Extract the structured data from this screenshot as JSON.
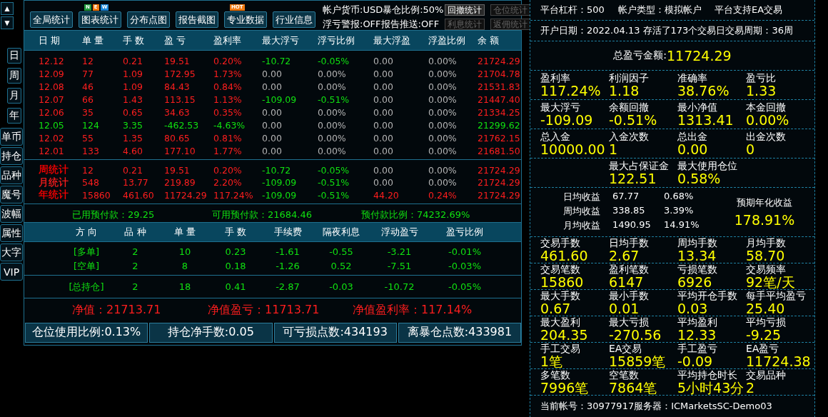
{
  "scroll_buttons": [
    "▲",
    "▼"
  ],
  "period_buttons": [
    "日",
    "周",
    "月",
    "年"
  ],
  "side_buttons": [
    "单币",
    "持仓",
    "品种",
    "魔号",
    "波幅",
    "属性",
    "大字",
    "VIP"
  ],
  "toolbar": {
    "buttons": [
      {
        "label": "全局统计"
      },
      {
        "label": "图表统计",
        "badges": [
          {
            "text": "N",
            "color": "#1f9a3c"
          },
          {
            "text": "E",
            "color": "#f07a12"
          },
          {
            "text": "W",
            "color": "#1a86d8"
          }
        ]
      },
      {
        "label": "分布点图"
      },
      {
        "label": "报告截图"
      },
      {
        "label": "专业数据",
        "badges": [
          {
            "text": "HOT",
            "color": "#f07a12"
          }
        ]
      },
      {
        "label": "行业信息"
      }
    ],
    "info_lines": [
      "帐户货币:USD暴仓比例:50%",
      "浮亏警报:OFF报告推送:OFF"
    ],
    "small_buttons": [
      {
        "label": "回撤统计",
        "disabled": false
      },
      {
        "label": "仓位统计",
        "disabled": true
      },
      {
        "label": "利息统计",
        "disabled": true
      },
      {
        "label": "返佣统计",
        "disabled": true
      }
    ]
  },
  "daily_table": {
    "columns": [
      "日 期",
      "单 量",
      "手 数",
      "盈 亏",
      "盈利率",
      "最大浮亏",
      "浮亏比例",
      "最大浮盈",
      "浮盈比例",
      "余 额"
    ],
    "rows": [
      [
        {
          "text": "12.12",
          "color": "#ff1e1e"
        },
        {
          "text": "12",
          "color": "#ff1e1e"
        },
        {
          "text": "0.21",
          "color": "#ff1e1e"
        },
        {
          "text": "19.51",
          "color": "#ff1e1e"
        },
        {
          "text": "0.20%",
          "color": "#ff1e1e"
        },
        {
          "text": "-10.72",
          "color": "#10e010"
        },
        {
          "text": "-0.05%",
          "color": "#10e010"
        },
        {
          "text": "0.00",
          "color": "#b4b4b4"
        },
        {
          "text": "0.00%",
          "color": "#b4b4b4"
        },
        {
          "text": "21724.29",
          "color": "#ff1e1e"
        }
      ],
      [
        {
          "text": "12.09",
          "color": "#ff1e1e"
        },
        {
          "text": "77",
          "color": "#ff1e1e"
        },
        {
          "text": "1.09",
          "color": "#ff1e1e"
        },
        {
          "text": "172.95",
          "color": "#ff1e1e"
        },
        {
          "text": "1.73%",
          "color": "#ff1e1e"
        },
        {
          "text": "0.00",
          "color": "#b4b4b4"
        },
        {
          "text": "0.00%",
          "color": "#b4b4b4"
        },
        {
          "text": "0.00",
          "color": "#b4b4b4"
        },
        {
          "text": "0.00%",
          "color": "#b4b4b4"
        },
        {
          "text": "21704.78",
          "color": "#ff1e1e"
        }
      ],
      [
        {
          "text": "12.08",
          "color": "#ff1e1e"
        },
        {
          "text": "46",
          "color": "#ff1e1e"
        },
        {
          "text": "1.09",
          "color": "#ff1e1e"
        },
        {
          "text": "84.43",
          "color": "#ff1e1e"
        },
        {
          "text": "0.84%",
          "color": "#ff1e1e"
        },
        {
          "text": "0.00",
          "color": "#b4b4b4"
        },
        {
          "text": "0.00%",
          "color": "#b4b4b4"
        },
        {
          "text": "0.00",
          "color": "#b4b4b4"
        },
        {
          "text": "0.00%",
          "color": "#b4b4b4"
        },
        {
          "text": "21531.83",
          "color": "#ff1e1e"
        }
      ],
      [
        {
          "text": "12.07",
          "color": "#ff1e1e"
        },
        {
          "text": "66",
          "color": "#ff1e1e"
        },
        {
          "text": "1.43",
          "color": "#ff1e1e"
        },
        {
          "text": "113.15",
          "color": "#ff1e1e"
        },
        {
          "text": "1.13%",
          "color": "#ff1e1e"
        },
        {
          "text": "-109.09",
          "color": "#10e010"
        },
        {
          "text": "-0.51%",
          "color": "#10e010"
        },
        {
          "text": "0.00",
          "color": "#b4b4b4"
        },
        {
          "text": "0.00%",
          "color": "#b4b4b4"
        },
        {
          "text": "21447.40",
          "color": "#ff1e1e"
        }
      ],
      [
        {
          "text": "12.06",
          "color": "#ff1e1e"
        },
        {
          "text": "35",
          "color": "#ff1e1e"
        },
        {
          "text": "0.65",
          "color": "#ff1e1e"
        },
        {
          "text": "34.63",
          "color": "#ff1e1e"
        },
        {
          "text": "0.35%",
          "color": "#ff1e1e"
        },
        {
          "text": "0.00",
          "color": "#b4b4b4"
        },
        {
          "text": "0.00%",
          "color": "#b4b4b4"
        },
        {
          "text": "0.00",
          "color": "#b4b4b4"
        },
        {
          "text": "0.00%",
          "color": "#b4b4b4"
        },
        {
          "text": "21334.25",
          "color": "#ff1e1e"
        }
      ],
      [
        {
          "text": "12.05",
          "color": "#10e010"
        },
        {
          "text": "124",
          "color": "#10e010"
        },
        {
          "text": "3.35",
          "color": "#10e010"
        },
        {
          "text": "-462.53",
          "color": "#10e010"
        },
        {
          "text": "-4.63%",
          "color": "#10e010"
        },
        {
          "text": "0.00",
          "color": "#b4b4b4"
        },
        {
          "text": "0.00%",
          "color": "#b4b4b4"
        },
        {
          "text": "0.00",
          "color": "#b4b4b4"
        },
        {
          "text": "0.00%",
          "color": "#b4b4b4"
        },
        {
          "text": "21299.62",
          "color": "#10e010"
        }
      ],
      [
        {
          "text": "12.02",
          "color": "#ff1e1e"
        },
        {
          "text": "55",
          "color": "#ff1e1e"
        },
        {
          "text": "1.35",
          "color": "#ff1e1e"
        },
        {
          "text": "80.65",
          "color": "#ff1e1e"
        },
        {
          "text": "0.81%",
          "color": "#ff1e1e"
        },
        {
          "text": "0.00",
          "color": "#b4b4b4"
        },
        {
          "text": "0.00%",
          "color": "#b4b4b4"
        },
        {
          "text": "0.00",
          "color": "#b4b4b4"
        },
        {
          "text": "0.00%",
          "color": "#b4b4b4"
        },
        {
          "text": "21762.15",
          "color": "#ff1e1e"
        }
      ],
      [
        {
          "text": "12.01",
          "color": "#ff1e1e"
        },
        {
          "text": "133",
          "color": "#ff1e1e"
        },
        {
          "text": "4.60",
          "color": "#ff1e1e"
        },
        {
          "text": "177.10",
          "color": "#ff1e1e"
        },
        {
          "text": "1.77%",
          "color": "#ff1e1e"
        },
        {
          "text": "0.00",
          "color": "#b4b4b4"
        },
        {
          "text": "0.00%",
          "color": "#b4b4b4"
        },
        {
          "text": "0.00",
          "color": "#b4b4b4"
        },
        {
          "text": "0.00%",
          "color": "#b4b4b4"
        },
        {
          "text": "21681.50",
          "color": "#ff1e1e"
        }
      ]
    ],
    "summary_rows": [
      [
        {
          "text": "周统计",
          "color": "#ff0000"
        },
        {
          "text": "12",
          "color": "#ff1e1e"
        },
        {
          "text": "0.21",
          "color": "#ff1e1e"
        },
        {
          "text": "19.51",
          "color": "#ff1e1e"
        },
        {
          "text": "0.20%",
          "color": "#ff1e1e"
        },
        {
          "text": "-10.72",
          "color": "#10e010"
        },
        {
          "text": "-0.05%",
          "color": "#10e010"
        },
        {
          "text": "0.00",
          "color": "#b4b4b4"
        },
        {
          "text": "0.00%",
          "color": "#b4b4b4"
        },
        {
          "text": "21724.29",
          "color": "#ff1e1e"
        }
      ],
      [
        {
          "text": "月统计",
          "color": "#ff1e1e"
        },
        {
          "text": "548",
          "color": "#ff1e1e"
        },
        {
          "text": "13.77",
          "color": "#ff1e1e"
        },
        {
          "text": "219.89",
          "color": "#ff1e1e"
        },
        {
          "text": "2.20%",
          "color": "#ff1e1e"
        },
        {
          "text": "-109.09",
          "color": "#10e010"
        },
        {
          "text": "-0.51%",
          "color": "#10e010"
        },
        {
          "text": "0.00",
          "color": "#b4b4b4"
        },
        {
          "text": "0.00%",
          "color": "#b4b4b4"
        },
        {
          "text": "21724.29",
          "color": "#ff1e1e"
        }
      ],
      [
        {
          "text": "年统计",
          "color": "#ff0000"
        },
        {
          "text": "15860",
          "color": "#ff1e1e"
        },
        {
          "text": "461.60",
          "color": "#ff1e1e"
        },
        {
          "text": "11724.29",
          "color": "#ff1e1e"
        },
        {
          "text": "117.24%",
          "color": "#ff1e1e"
        },
        {
          "text": "-109.09",
          "color": "#10e010"
        },
        {
          "text": "-0.51%",
          "color": "#10e010"
        },
        {
          "text": "44.20",
          "color": "#ff1e1e"
        },
        {
          "text": "0.24%",
          "color": "#ff1e1e"
        },
        {
          "text": "21724.29",
          "color": "#ff1e1e"
        }
      ]
    ]
  },
  "margin_line": [
    "已用预付款：29.25",
    "可用预付款：21684.46",
    "预付款比例：74232.69%"
  ],
  "positions_table": {
    "columns": [
      "方 向",
      "品 种",
      "单 量",
      "手 数",
      "手续费",
      "隔夜利息",
      "浮动盈亏",
      "盈亏比例"
    ],
    "rows": [
      [
        "[多单]",
        "2",
        "10",
        "0.23",
        "-1.61",
        "-0.55",
        "-3.21",
        "-0.01%"
      ],
      [
        "[空单]",
        "2",
        "8",
        "0.18",
        "-1.26",
        "0.52",
        "-7.51",
        "-0.03%"
      ]
    ],
    "total_row": [
      "[总持仓]",
      "2",
      "18",
      "0.41",
      "-2.87",
      "-0.03",
      "-10.72",
      "-0.05%"
    ]
  },
  "equity_line": [
    "净值：21713.71",
    "净值盈亏：11713.71",
    "净值盈利率：117.14%"
  ],
  "bottom_stats": [
    "仓位使用比例:0.13%",
    "持仓净手数:0.05",
    "可亏损点数:434193",
    "离暴仓点数:433981"
  ],
  "stats_panel": {
    "account_line": [
      "平台杠杆：500",
      "帐户类型：模拟帐户",
      "平台支持EA交易"
    ],
    "open_info": "开户日期：2022.04.13 存活了173个交易日交易周期：36周",
    "total_label": "总盈亏金额:",
    "total_value": "11724.29",
    "groups_top": [
      [
        {
          "label": "盈利率",
          "value": "117.24%"
        },
        {
          "label": "利润因子",
          "value": "1.18"
        },
        {
          "label": "准确率",
          "value": "38.76%"
        },
        {
          "label": "盈亏比",
          "value": "1.33"
        }
      ],
      [
        {
          "label": "最大浮亏",
          "value": "-109.09"
        },
        {
          "label": "余额回撤",
          "value": "-0.51%"
        },
        {
          "label": "最小净值",
          "value": "1313.41"
        },
        {
          "label": "本金回撤",
          "value": "0.00%"
        }
      ],
      [
        {
          "label": "总入金",
          "value": "10000.00"
        },
        {
          "label": "入金次数",
          "value": "1"
        },
        {
          "label": "总出金",
          "value": "0.00"
        },
        {
          "label": "出金次数",
          "value": "0"
        }
      ]
    ],
    "margin_row": [
      {
        "label": "最大占保证金",
        "value": "122.51"
      },
      {
        "label": "最大使用仓位",
        "value": "0.58%"
      }
    ],
    "averages": [
      [
        "日均收益",
        "67.77",
        "0.68%"
      ],
      [
        "周均收益",
        "338.85",
        "3.39%"
      ],
      [
        "月均收益",
        "1490.95",
        "14.91%"
      ]
    ],
    "annual_label": "预期年化收益",
    "annual_value": "178.91%",
    "groups_bottom": [
      [
        {
          "label": "交易手数",
          "value": "461.60"
        },
        {
          "label": "日均手数",
          "value": "2.67"
        },
        {
          "label": "周均手数",
          "value": "13.34"
        },
        {
          "label": "月均手数",
          "value": "58.70"
        }
      ],
      [
        {
          "label": "交易笔数",
          "value": "15860"
        },
        {
          "label": "盈利笔数",
          "value": "6147"
        },
        {
          "label": "亏损笔数",
          "value": "6926"
        },
        {
          "label": "交易频率",
          "value": "92笔/天"
        }
      ],
      [
        {
          "label": "最大手数",
          "value": "0.67"
        },
        {
          "label": "最小手数",
          "value": "0.01"
        },
        {
          "label": "平均开仓手数",
          "value": "0.03"
        },
        {
          "label": "每手平均盈亏",
          "value": "25.40"
        }
      ],
      [
        {
          "label": "最大盈利",
          "value": "204.35"
        },
        {
          "label": "最大亏损",
          "value": "-270.56"
        },
        {
          "label": "平均盈利",
          "value": "12.33"
        },
        {
          "label": "平均亏损",
          "value": "-9.25"
        }
      ],
      [
        {
          "label": "手工交易",
          "value": "1笔"
        },
        {
          "label": "EA交易",
          "value": "15859笔"
        },
        {
          "label": "手工盈亏",
          "value": "-0.09"
        },
        {
          "label": "EA盈亏",
          "value": "11724.38"
        }
      ],
      [
        {
          "label": "多笔数",
          "value": "7996笔"
        },
        {
          "label": "空笔数",
          "value": "7864笔"
        },
        {
          "label": "平均持仓时长",
          "value": "5小时43分"
        },
        {
          "label": "交易品种",
          "value": "2"
        }
      ]
    ],
    "footer": "当前帐号：30977917服务器：ICMarketsSC-Demo03"
  }
}
